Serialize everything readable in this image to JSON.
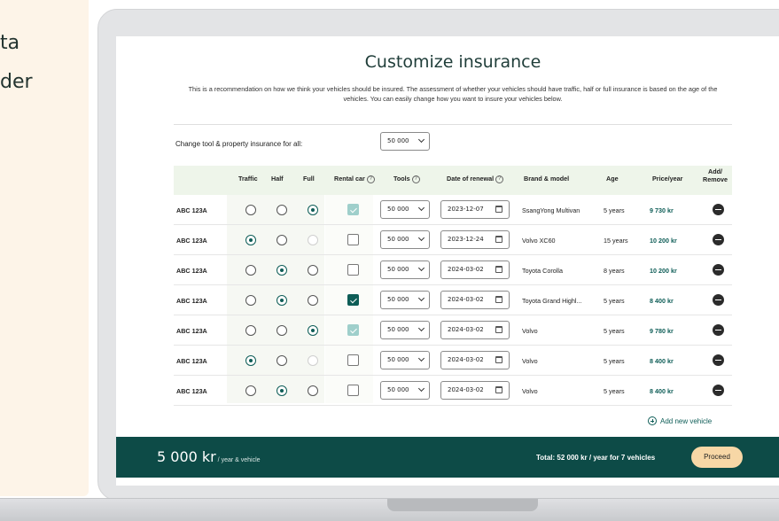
{
  "background": {
    "text_line1": "ta",
    "text_line2": "der"
  },
  "title": "Customize insurance",
  "description": "This is a recommendation on how we think your vehicles should be insured. The assessment of whether your vehicles should have traffic, half or full insurance is based on the age of the vehicles. You can easily change how you want to insure your vehicles below.",
  "change_all": {
    "label": "Change tool & property insurance for all:",
    "value": "50 000"
  },
  "headers": {
    "traffic": "Traffic",
    "half": "Half",
    "full": "Full",
    "rental": "Rental car",
    "tools": "Tools",
    "renewal": "Date of renewal",
    "brand": "Brand & model",
    "age": "Age",
    "price": "Price/year",
    "add_remove_1": "Add/",
    "add_remove_2": "Remove",
    "help_glyph": "?"
  },
  "rows": [
    {
      "reg": "ABC 123A",
      "coverage": "full",
      "traffic_disabled": false,
      "rental": "checked-disabled",
      "tools": "50 000",
      "renewal": "2023-12-07",
      "brand": "SsangYong Multivan",
      "age": "5 years",
      "price": "9 730 kr"
    },
    {
      "reg": "ABC 123A",
      "coverage": "traffic",
      "full_disabled": true,
      "rental": "unchecked",
      "tools": "50 000",
      "renewal": "2023-12-24",
      "brand": "Volvo XC60",
      "age": "15 years",
      "price": "10 200 kr"
    },
    {
      "reg": "ABC 123A",
      "coverage": "half",
      "rental": "unchecked",
      "tools": "50 000",
      "renewal": "2024-03-02",
      "brand": "Toyota Corolla",
      "age": "8 years",
      "price": "10 200 kr"
    },
    {
      "reg": "ABC 123A",
      "coverage": "half",
      "rental": "checked",
      "tools": "50 000",
      "renewal": "2024-03-02",
      "brand": "Toyota Grand Highl...",
      "age": "5 years",
      "price": "8 400 kr"
    },
    {
      "reg": "ABC 123A",
      "coverage": "full",
      "rental": "checked-disabled",
      "tools": "50 000",
      "renewal": "2024-03-02",
      "brand": "Volvo",
      "age": "5 years",
      "price": "9 780 kr"
    },
    {
      "reg": "ABC 123A",
      "coverage": "traffic",
      "full_disabled": true,
      "rental": "unchecked",
      "tools": "50 000",
      "renewal": "2024-03-02",
      "brand": "Volvo",
      "age": "5 years",
      "price": "8 400 kr"
    },
    {
      "reg": "ABC 123A",
      "coverage": "half",
      "rental": "unchecked",
      "tools": "50 000",
      "renewal": "2024-03-02",
      "brand": "Volvo",
      "age": "5 years",
      "price": "8 400 kr"
    }
  ],
  "add_new_vehicle": "Add new vehicle",
  "footer": {
    "price": "5 000 kr",
    "price_suffix": " / year & vehicle",
    "total": "Total: 52 000 kr / year for 7 vehicles",
    "proceed": "Proceed"
  },
  "colors": {
    "primary": "#0e5d57",
    "footer_bg": "#0d4b47",
    "accent": "#f7d7a6",
    "header_band": "#eef5ea",
    "side_panel": "#fdf4e8"
  }
}
